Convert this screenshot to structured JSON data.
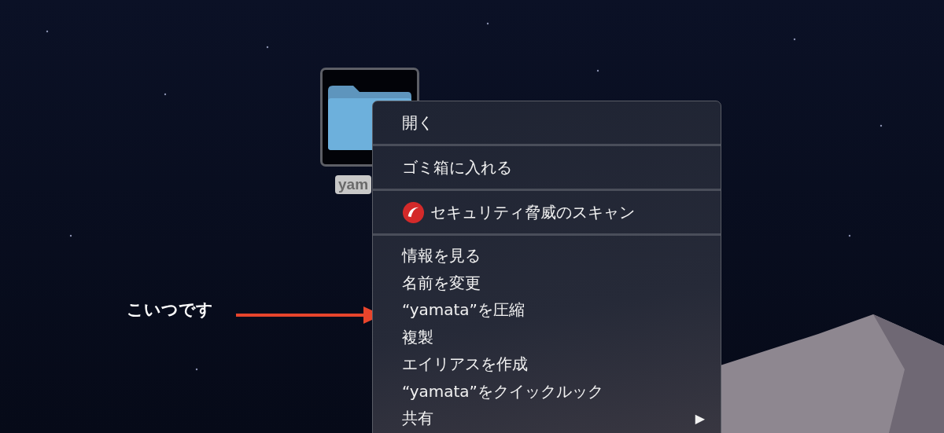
{
  "desktop": {
    "folder": {
      "name": "yam",
      "selected": true
    }
  },
  "annotation": {
    "text": "こいつです"
  },
  "context_menu": {
    "sections": [
      [
        {
          "label": "開く",
          "kind": "plain"
        }
      ],
      [
        {
          "label": "ゴミ箱に入れる",
          "kind": "plain"
        }
      ],
      [
        {
          "label": "セキュリティ脅威のスキャン",
          "kind": "icon"
        }
      ],
      [
        {
          "label": "情報を見る",
          "kind": "plain"
        },
        {
          "label": "名前を変更",
          "kind": "plain"
        },
        {
          "label": "“yamata”を圧縮",
          "kind": "plain"
        },
        {
          "label": "複製",
          "kind": "plain"
        },
        {
          "label": "エイリアスを作成",
          "kind": "plain"
        },
        {
          "label": "“yamata”をクイックルック",
          "kind": "plain"
        },
        {
          "label": "共有",
          "kind": "submenu",
          "arrow": "▶"
        }
      ]
    ]
  }
}
